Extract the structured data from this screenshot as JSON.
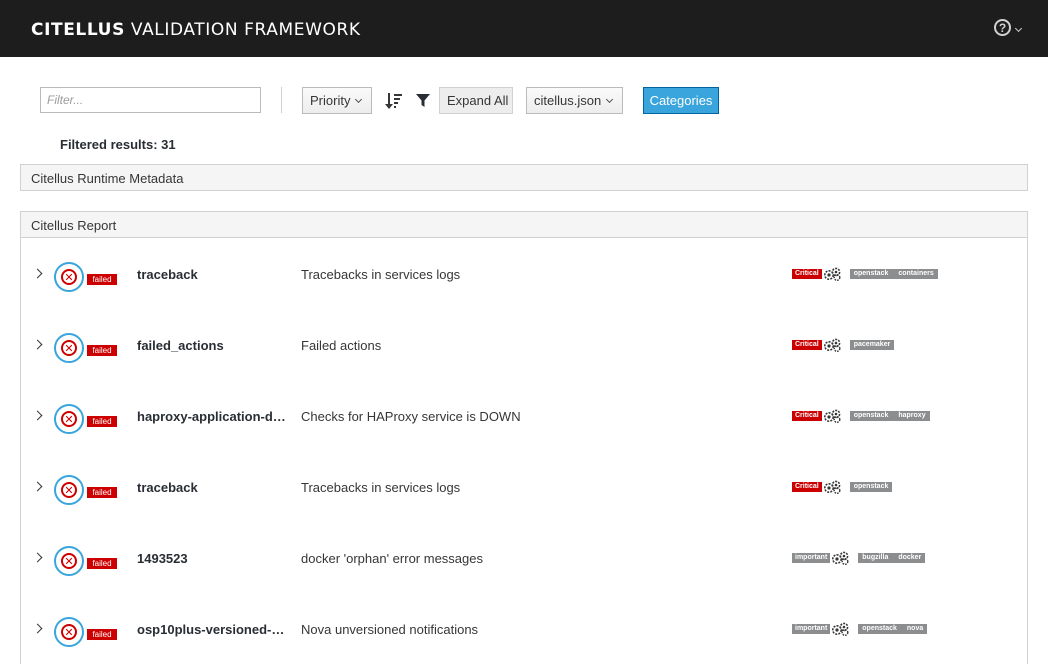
{
  "header": {
    "brand_bold": "CITELLUS",
    "brand_rest": " VALIDATION FRAMEWORK",
    "help_icon": "question-circle-icon"
  },
  "toolbar": {
    "filter_placeholder": "Filter...",
    "filter_value": "",
    "priority_label": "Priority",
    "sort_icon": "sort-amount-desc-icon",
    "filter_icon": "funnel-icon",
    "expand_all_label": "Expand All",
    "source_label": "citellus.json",
    "categories_label": "Categories"
  },
  "results": {
    "text": "Filtered results: 31"
  },
  "panels": {
    "metadata_title": "Citellus Runtime Metadata",
    "report_title": "Citellus Report"
  },
  "colors": {
    "navbar": "#1d1d1d",
    "critical": "#cc0000",
    "important": "#8b8d8f",
    "primary": "#39a5dc",
    "status_ring": "#39a5dc"
  },
  "rows": [
    {
      "status_icon": "error-circle-icon",
      "status": "failed",
      "name": "traceback",
      "description": "Tracebacks in services logs",
      "severity": "Critical",
      "severity_type": "critical",
      "plugin_icon": "gears-icon",
      "categories": [
        "openstack",
        "containers"
      ]
    },
    {
      "status_icon": "error-circle-icon",
      "status": "failed",
      "name": "failed_actions",
      "description": "Failed actions",
      "severity": "Critical",
      "severity_type": "critical",
      "plugin_icon": "gears-icon",
      "categories": [
        "pacemaker"
      ]
    },
    {
      "status_icon": "error-circle-icon",
      "status": "failed",
      "name": "haproxy-application-do...",
      "description": "Checks for HAProxy service is DOWN",
      "severity": "Critical",
      "severity_type": "critical",
      "plugin_icon": "gears-icon",
      "categories": [
        "openstack",
        "haproxy"
      ]
    },
    {
      "status_icon": "error-circle-icon",
      "status": "failed",
      "name": "traceback",
      "description": "Tracebacks in services logs",
      "severity": "Critical",
      "severity_type": "critical",
      "plugin_icon": "gears-icon",
      "categories": [
        "openstack"
      ]
    },
    {
      "status_icon": "error-circle-icon",
      "status": "failed",
      "name": "1493523",
      "description": "docker 'orphan' error messages",
      "severity": "important",
      "severity_type": "important",
      "plugin_icon": "gears-icon",
      "categories": [
        "bugzilla",
        "docker"
      ]
    },
    {
      "status_icon": "error-circle-icon",
      "status": "failed",
      "name": "osp10plus-versioned-n...",
      "description": "Nova unversioned notifications",
      "severity": "important",
      "severity_type": "important",
      "plugin_icon": "gears-icon",
      "categories": [
        "openstack",
        "nova"
      ]
    }
  ]
}
